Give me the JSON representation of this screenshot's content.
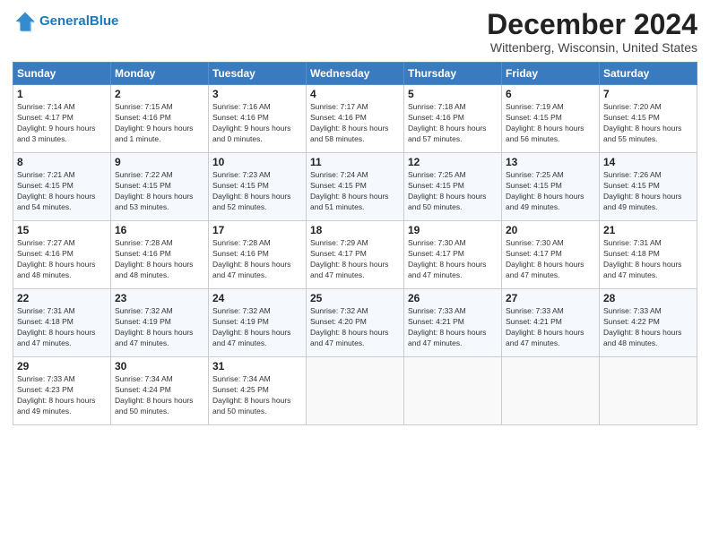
{
  "header": {
    "logo_line1": "General",
    "logo_line2": "Blue",
    "title": "December 2024",
    "location": "Wittenberg, Wisconsin, United States"
  },
  "weekdays": [
    "Sunday",
    "Monday",
    "Tuesday",
    "Wednesday",
    "Thursday",
    "Friday",
    "Saturday"
  ],
  "weeks": [
    [
      {
        "day": "1",
        "sunrise": "Sunrise: 7:14 AM",
        "sunset": "Sunset: 4:17 PM",
        "daylight": "Daylight: 9 hours and 3 minutes."
      },
      {
        "day": "2",
        "sunrise": "Sunrise: 7:15 AM",
        "sunset": "Sunset: 4:16 PM",
        "daylight": "Daylight: 9 hours and 1 minute."
      },
      {
        "day": "3",
        "sunrise": "Sunrise: 7:16 AM",
        "sunset": "Sunset: 4:16 PM",
        "daylight": "Daylight: 9 hours and 0 minutes."
      },
      {
        "day": "4",
        "sunrise": "Sunrise: 7:17 AM",
        "sunset": "Sunset: 4:16 PM",
        "daylight": "Daylight: 8 hours and 58 minutes."
      },
      {
        "day": "5",
        "sunrise": "Sunrise: 7:18 AM",
        "sunset": "Sunset: 4:16 PM",
        "daylight": "Daylight: 8 hours and 57 minutes."
      },
      {
        "day": "6",
        "sunrise": "Sunrise: 7:19 AM",
        "sunset": "Sunset: 4:15 PM",
        "daylight": "Daylight: 8 hours and 56 minutes."
      },
      {
        "day": "7",
        "sunrise": "Sunrise: 7:20 AM",
        "sunset": "Sunset: 4:15 PM",
        "daylight": "Daylight: 8 hours and 55 minutes."
      }
    ],
    [
      {
        "day": "8",
        "sunrise": "Sunrise: 7:21 AM",
        "sunset": "Sunset: 4:15 PM",
        "daylight": "Daylight: 8 hours and 54 minutes."
      },
      {
        "day": "9",
        "sunrise": "Sunrise: 7:22 AM",
        "sunset": "Sunset: 4:15 PM",
        "daylight": "Daylight: 8 hours and 53 minutes."
      },
      {
        "day": "10",
        "sunrise": "Sunrise: 7:23 AM",
        "sunset": "Sunset: 4:15 PM",
        "daylight": "Daylight: 8 hours and 52 minutes."
      },
      {
        "day": "11",
        "sunrise": "Sunrise: 7:24 AM",
        "sunset": "Sunset: 4:15 PM",
        "daylight": "Daylight: 8 hours and 51 minutes."
      },
      {
        "day": "12",
        "sunrise": "Sunrise: 7:25 AM",
        "sunset": "Sunset: 4:15 PM",
        "daylight": "Daylight: 8 hours and 50 minutes."
      },
      {
        "day": "13",
        "sunrise": "Sunrise: 7:25 AM",
        "sunset": "Sunset: 4:15 PM",
        "daylight": "Daylight: 8 hours and 49 minutes."
      },
      {
        "day": "14",
        "sunrise": "Sunrise: 7:26 AM",
        "sunset": "Sunset: 4:15 PM",
        "daylight": "Daylight: 8 hours and 49 minutes."
      }
    ],
    [
      {
        "day": "15",
        "sunrise": "Sunrise: 7:27 AM",
        "sunset": "Sunset: 4:16 PM",
        "daylight": "Daylight: 8 hours and 48 minutes."
      },
      {
        "day": "16",
        "sunrise": "Sunrise: 7:28 AM",
        "sunset": "Sunset: 4:16 PM",
        "daylight": "Daylight: 8 hours and 48 minutes."
      },
      {
        "day": "17",
        "sunrise": "Sunrise: 7:28 AM",
        "sunset": "Sunset: 4:16 PM",
        "daylight": "Daylight: 8 hours and 47 minutes."
      },
      {
        "day": "18",
        "sunrise": "Sunrise: 7:29 AM",
        "sunset": "Sunset: 4:17 PM",
        "daylight": "Daylight: 8 hours and 47 minutes."
      },
      {
        "day": "19",
        "sunrise": "Sunrise: 7:30 AM",
        "sunset": "Sunset: 4:17 PM",
        "daylight": "Daylight: 8 hours and 47 minutes."
      },
      {
        "day": "20",
        "sunrise": "Sunrise: 7:30 AM",
        "sunset": "Sunset: 4:17 PM",
        "daylight": "Daylight: 8 hours and 47 minutes."
      },
      {
        "day": "21",
        "sunrise": "Sunrise: 7:31 AM",
        "sunset": "Sunset: 4:18 PM",
        "daylight": "Daylight: 8 hours and 47 minutes."
      }
    ],
    [
      {
        "day": "22",
        "sunrise": "Sunrise: 7:31 AM",
        "sunset": "Sunset: 4:18 PM",
        "daylight": "Daylight: 8 hours and 47 minutes."
      },
      {
        "day": "23",
        "sunrise": "Sunrise: 7:32 AM",
        "sunset": "Sunset: 4:19 PM",
        "daylight": "Daylight: 8 hours and 47 minutes."
      },
      {
        "day": "24",
        "sunrise": "Sunrise: 7:32 AM",
        "sunset": "Sunset: 4:19 PM",
        "daylight": "Daylight: 8 hours and 47 minutes."
      },
      {
        "day": "25",
        "sunrise": "Sunrise: 7:32 AM",
        "sunset": "Sunset: 4:20 PM",
        "daylight": "Daylight: 8 hours and 47 minutes."
      },
      {
        "day": "26",
        "sunrise": "Sunrise: 7:33 AM",
        "sunset": "Sunset: 4:21 PM",
        "daylight": "Daylight: 8 hours and 47 minutes."
      },
      {
        "day": "27",
        "sunrise": "Sunrise: 7:33 AM",
        "sunset": "Sunset: 4:21 PM",
        "daylight": "Daylight: 8 hours and 47 minutes."
      },
      {
        "day": "28",
        "sunrise": "Sunrise: 7:33 AM",
        "sunset": "Sunset: 4:22 PM",
        "daylight": "Daylight: 8 hours and 48 minutes."
      }
    ],
    [
      {
        "day": "29",
        "sunrise": "Sunrise: 7:33 AM",
        "sunset": "Sunset: 4:23 PM",
        "daylight": "Daylight: 8 hours and 49 minutes."
      },
      {
        "day": "30",
        "sunrise": "Sunrise: 7:34 AM",
        "sunset": "Sunset: 4:24 PM",
        "daylight": "Daylight: 8 hours and 50 minutes."
      },
      {
        "day": "31",
        "sunrise": "Sunrise: 7:34 AM",
        "sunset": "Sunset: 4:25 PM",
        "daylight": "Daylight: 8 hours and 50 minutes."
      },
      null,
      null,
      null,
      null
    ]
  ]
}
